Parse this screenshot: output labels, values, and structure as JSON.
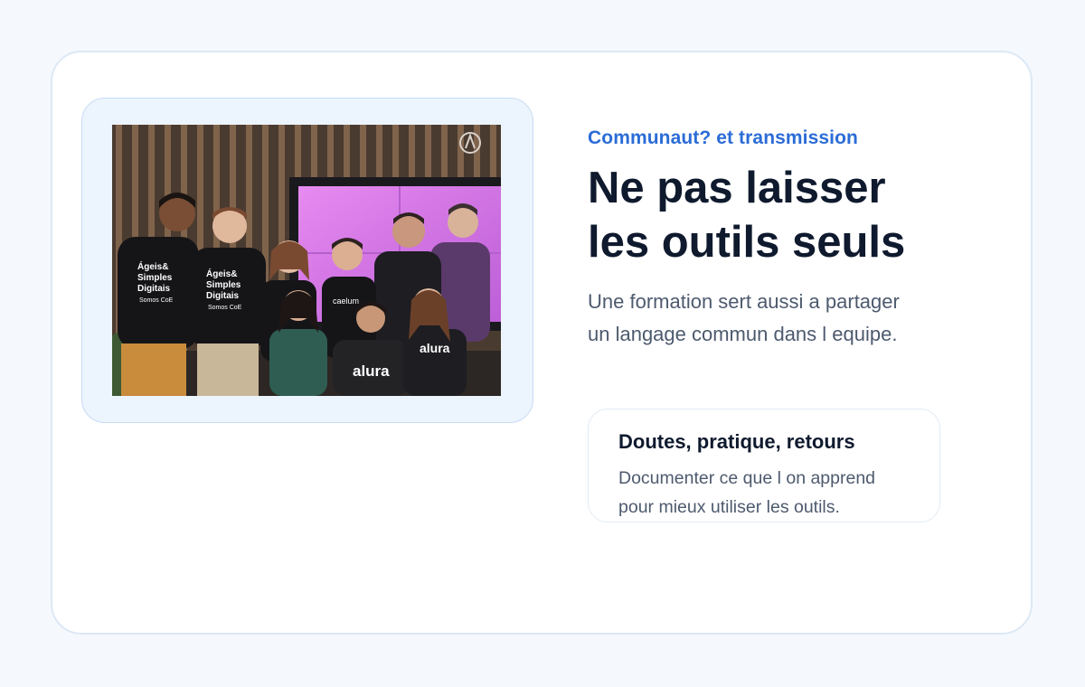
{
  "photo": {
    "shirt_texts": [
      "Ágeis&",
      "Simples",
      "Digitais",
      "Somos CoE",
      "caelum",
      "alura"
    ]
  },
  "section": {
    "eyebrow": "Communaut? et transmission",
    "headline_line1": "Ne pas laisser",
    "headline_line2": "les outils seuls",
    "lede_line1": "Une formation sert aussi a partager",
    "lede_line2": "un langage commun dans l equipe."
  },
  "note_card": {
    "title": "Doutes, pratique, retours",
    "body_line1": "Documenter ce que l on apprend",
    "body_line2": "pour mieux utiliser les outils."
  },
  "colors": {
    "page_bg": "#f5f9fd",
    "card_border": "#dce8f5",
    "accent": "#2b6cd6",
    "heading": "#0f1a2e",
    "body_text": "#4d5a6e",
    "photo_frame_bg": "#ecf4fe"
  }
}
